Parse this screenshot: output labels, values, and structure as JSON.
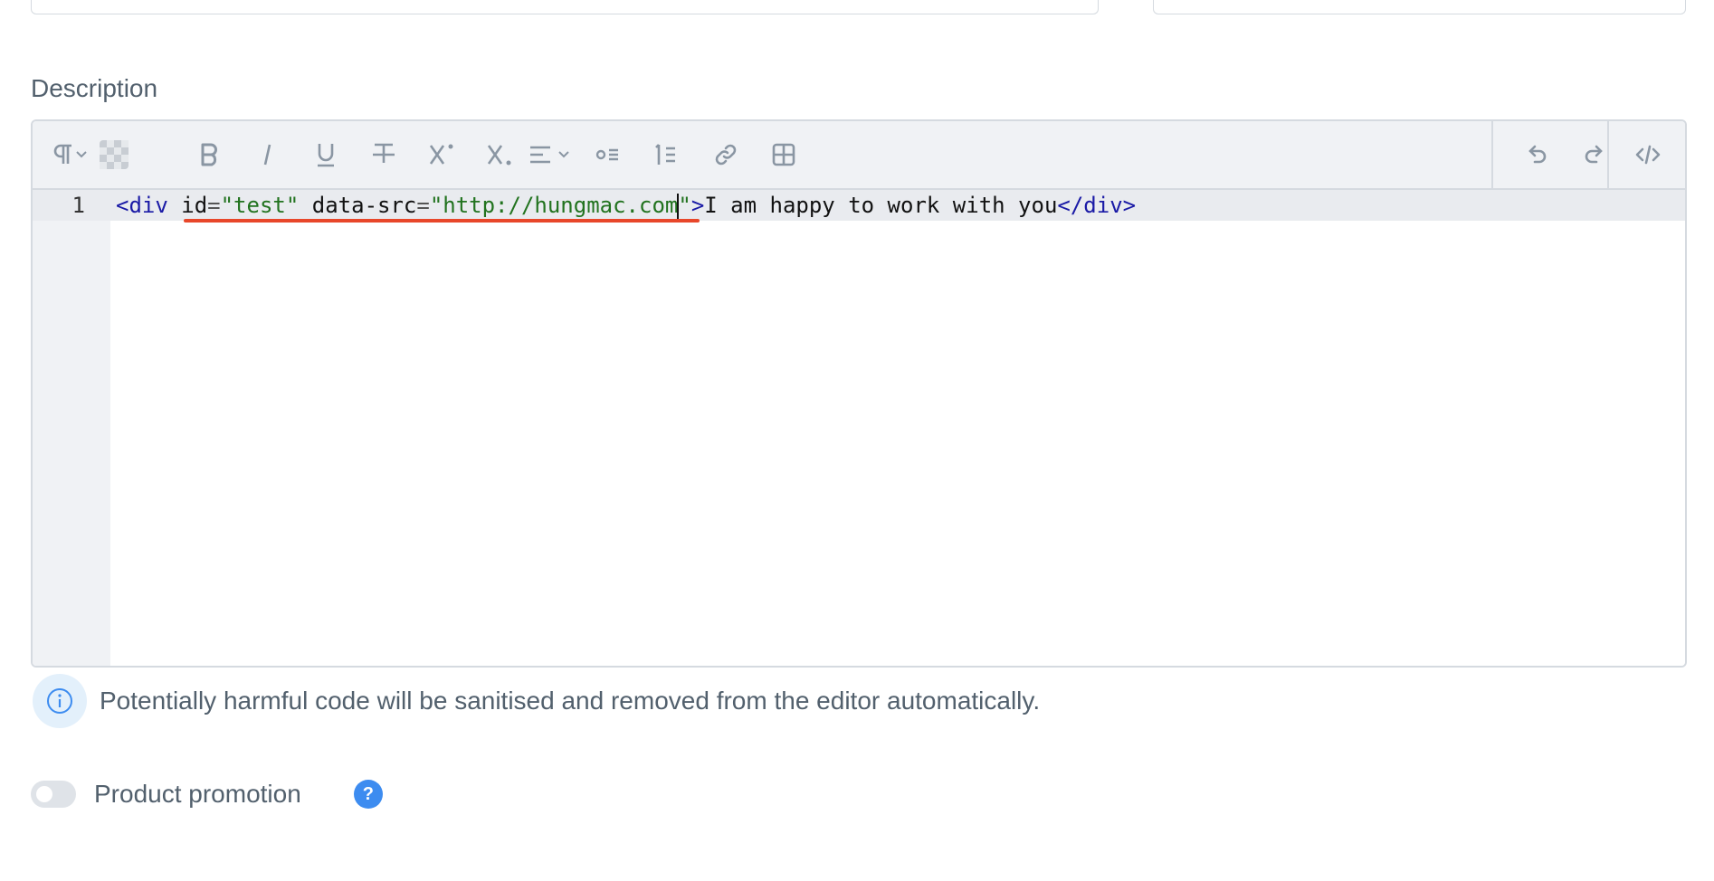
{
  "description_label": "Description",
  "toolbar": {
    "paragraph": "paragraph-icon",
    "background": "checker-icon",
    "bold": "bold-icon",
    "italic": "italic-icon",
    "underline": "underline-icon",
    "strikethrough": "strikethrough-icon",
    "superscript": "superscript-icon",
    "subscript": "subscript-icon",
    "align": "align-icon",
    "bullet_list": "bullet-list-icon",
    "numbered_list": "numbered-list-icon",
    "link": "link-icon",
    "table": "table-icon",
    "undo": "undo-icon",
    "redo": "redo-icon",
    "code_view": "code-view-icon"
  },
  "code": {
    "line_number": "1",
    "tag_open": "<div",
    "attr1_name": "id",
    "eq": "=",
    "attr1_value": "\"test\"",
    "attr2_name": "data-src",
    "attr2_value_part": "\"http://hungmac.com",
    "attr2_value_end": "\"",
    "gt": ">",
    "text": "I am happy to work with you",
    "tag_close": "</div>"
  },
  "notice": {
    "text": "Potentially harmful code will be sanitised and removed from the editor automatically.",
    "icon": "info-icon"
  },
  "promotion": {
    "label": "Product promotion",
    "enabled": false,
    "help_glyph": "?"
  },
  "colors": {
    "underline_highlight": "#e8472a",
    "help_icon": "#3d8cf0",
    "tag": "#1a1aa6",
    "string": "#22731f"
  }
}
